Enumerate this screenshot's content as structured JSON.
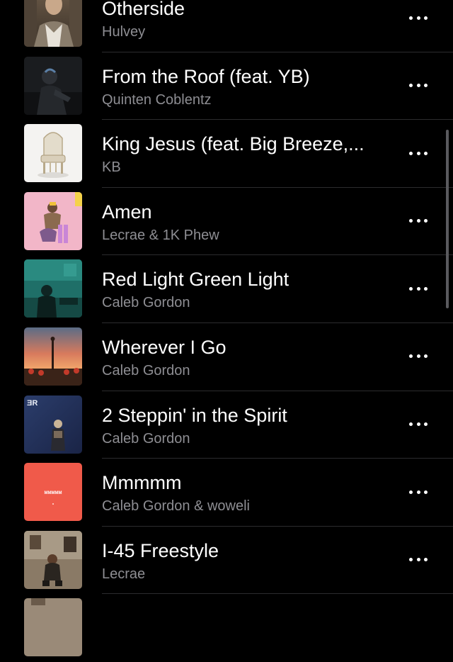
{
  "songs": [
    {
      "title": "Otherside",
      "artist": "Hulvey",
      "art": "art-otherside"
    },
    {
      "title": "From the Roof (feat. YB)",
      "artist": "Quinten Coblentz",
      "art": "art-from-the-roof"
    },
    {
      "title": "King Jesus (feat. Big Breeze,...",
      "artist": "KB",
      "art": "art-king-jesus"
    },
    {
      "title": "Amen",
      "artist": "Lecrae & 1K Phew",
      "art": "art-amen"
    },
    {
      "title": "Red Light Green Light",
      "artist": "Caleb Gordon",
      "art": "art-red-light-green-light"
    },
    {
      "title": "Wherever I Go",
      "artist": "Caleb Gordon",
      "art": "art-wherever-i-go"
    },
    {
      "title": "2 Steppin' in the Spirit",
      "artist": "Caleb Gordon",
      "art": "art-2-steppin"
    },
    {
      "title": "Mmmmm",
      "artist": "Caleb Gordon & woweli",
      "art": "art-mmmmm"
    },
    {
      "title": "I-45 Freestyle",
      "artist": "Lecrae",
      "art": "art-i45-freestyle"
    }
  ],
  "more_icon": "ellipsis-icon",
  "colors": {
    "background": "#000000",
    "title": "#ffffff",
    "subtitle": "#8e8e93",
    "divider": "#2c2c2e"
  },
  "art_labels": {
    "steppin_logo": "ƎR",
    "mmmmm_text": "MMMMM"
  }
}
